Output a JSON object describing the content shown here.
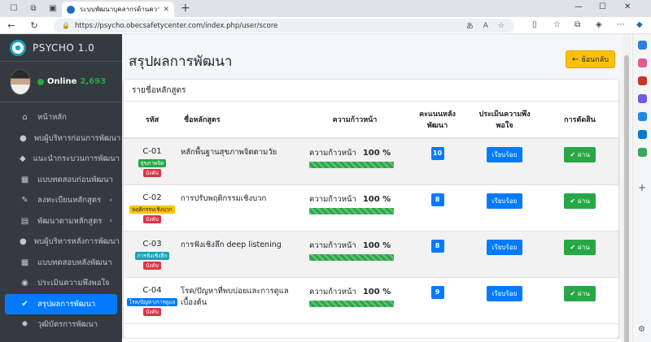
{
  "browser": {
    "tab_title": "ระบบพัฒนาบุคลากรด้านความปลอดภัย",
    "url": "https://psycho.obecsafetycenter.com/index.php/user/score",
    "new_tab_glyph": "+"
  },
  "sidebar": {
    "brand": "PSYCHO 1.0",
    "online_label": "Online",
    "online_count": "2,693",
    "items": [
      {
        "label": "หน้าหลัก",
        "icon": "home-icon",
        "glyph": "⌂"
      },
      {
        "label": "พบผู้บริหารก่อนการพัฒนา",
        "icon": "user-icon",
        "glyph": "●"
      },
      {
        "label": "แนะนำกระบวนการพัฒนา",
        "icon": "tags-icon",
        "glyph": "◆"
      },
      {
        "label": "แบบทดสอบก่อนพัฒนา",
        "icon": "table-icon",
        "glyph": "▦"
      },
      {
        "label": "ลงทะเบียนหลักสูตร",
        "icon": "edit-icon",
        "glyph": "✎",
        "chevron": "‹"
      },
      {
        "label": "พัฒนาตามหลักสูตร",
        "icon": "layers-icon",
        "glyph": "▤",
        "chevron": "‹"
      },
      {
        "label": "พบผู้บริหารหลังการพัฒนา",
        "icon": "user-icon",
        "glyph": "●"
      },
      {
        "label": "แบบทดสอบหลังพัฒนา",
        "icon": "table-icon",
        "glyph": "▦"
      },
      {
        "label": "ประเมินความพึงพอใจ",
        "icon": "comment-icon",
        "glyph": "◉"
      },
      {
        "label": "สรุปผลการพัฒนา",
        "icon": "check-icon",
        "glyph": "✔",
        "active": true
      },
      {
        "label": "วุฒิบัตรการพัฒนา",
        "icon": "certificate-icon",
        "glyph": "✹"
      }
    ]
  },
  "main": {
    "page_title": "สรุปผลการพัฒนา",
    "back_label": "ย้อนกลับ",
    "card_title": "รายชื่อหลักสูตร",
    "columns": {
      "code": "รหัส",
      "name": "ชื่อหลักสูตร",
      "progress": "ความก้าวหน้า",
      "score": "คะแนนหลังพัฒนา",
      "eval": "ประเมินความพึงพอใจ",
      "decision": "การตัดสิน"
    },
    "progress_label": "ความก้าวหน้า",
    "rows": [
      {
        "code": "C-01",
        "tag": "สุขภาพจิต",
        "tag_color": "#28a745",
        "tag_text_color": "#ffffff",
        "req": "บังคับ",
        "name": "หลักพื้นฐานสุขภาพจิตตามวัย",
        "progress_pct": "100 %",
        "progress_value": 100,
        "score": "10",
        "eval": "เรียบร้อย",
        "decision": "ผ่าน"
      },
      {
        "code": "C-02",
        "tag": "พฤติกรรมเชิงบวก",
        "tag_color": "#ffc107",
        "tag_text_color": "#212529",
        "req": "บังคับ",
        "name": "การปรับพฤติกรรมเชิงบวก",
        "progress_pct": "100 %",
        "progress_value": 100,
        "score": "8",
        "eval": "เรียบร้อย",
        "decision": "ผ่าน"
      },
      {
        "code": "C-03",
        "tag": "การฟังเชิงลึก",
        "tag_color": "#17a2b8",
        "tag_text_color": "#ffffff",
        "req": "บังคับ",
        "name": "การฟังเชิงลึก deep listening",
        "progress_pct": "100 %",
        "progress_value": 100,
        "score": "8",
        "eval": "เรียบร้อย",
        "decision": "ผ่าน"
      },
      {
        "code": "C-04",
        "tag": "โรค/ปัญหา/การดูแล",
        "tag_color": "#007bff",
        "tag_text_color": "#ffffff",
        "req": "บังคับ",
        "name": "โรค/ปัญหาที่พบบ่อยและการดูแลเบื้องต้น",
        "progress_pct": "100 %",
        "progress_value": 100,
        "score": "9",
        "eval": "เรียบร้อย",
        "decision": "ผ่าน"
      }
    ]
  },
  "colors": {
    "sidebar_bg": "#343a40",
    "active": "#007bff",
    "success": "#28a745",
    "warning": "#ffc107",
    "danger": "#dc3545"
  }
}
